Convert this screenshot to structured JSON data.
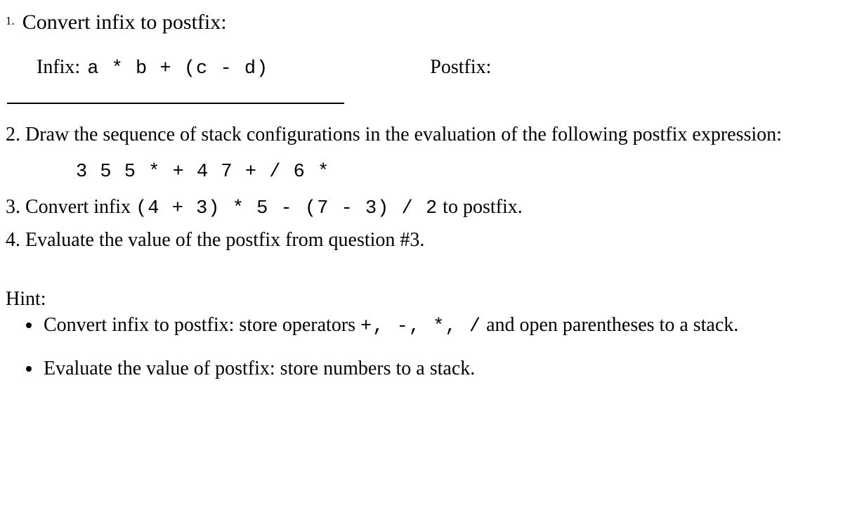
{
  "q1": {
    "label": "1.",
    "text": "Convert infix to postfix:",
    "infix_label": "Infix:",
    "infix_expr": "a * b + (c - d)",
    "postfix_label": "Postfix:"
  },
  "q2": {
    "text": "2. Draw the sequence of stack configurations in the evaluation of the following postfix expression:",
    "expr": "3 5 5 * + 4 7 + / 6 *"
  },
  "q3": {
    "prefix": "3. Convert infix ",
    "expr": "(4 + 3) * 5 - (7 - 3) / 2",
    "suffix": " to postfix."
  },
  "q4": {
    "text": "4. Evaluate the value of the postfix from question #3."
  },
  "hint": {
    "header": "Hint:",
    "b1_prefix": "Convert infix to postfix: store operators ",
    "b1_ops": "+, -, *, /",
    "b1_suffix": " and open parentheses to a stack.",
    "b2": "Evaluate the value of postfix: store numbers to a stack."
  }
}
